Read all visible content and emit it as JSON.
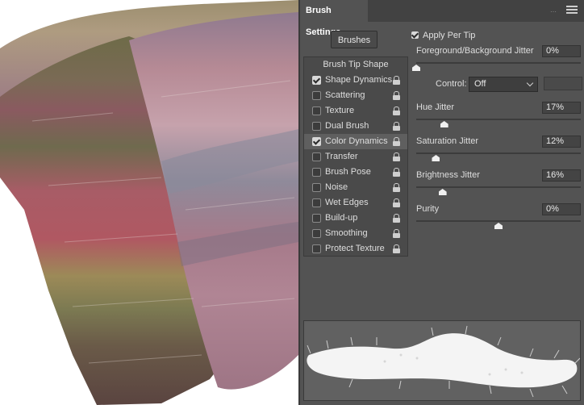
{
  "panel": {
    "tab_title": "Brush Settings",
    "brushes_button": "Brushes",
    "options": [
      {
        "label": "Brush Tip Shape",
        "checkbox": false,
        "checked": false,
        "lock": false,
        "selected": false
      },
      {
        "label": "Shape Dynamics",
        "checkbox": true,
        "checked": true,
        "lock": true,
        "selected": false
      },
      {
        "label": "Scattering",
        "checkbox": true,
        "checked": false,
        "lock": true,
        "selected": false
      },
      {
        "label": "Texture",
        "checkbox": true,
        "checked": false,
        "lock": true,
        "selected": false
      },
      {
        "label": "Dual Brush",
        "checkbox": true,
        "checked": false,
        "lock": true,
        "selected": false
      },
      {
        "label": "Color Dynamics",
        "checkbox": true,
        "checked": true,
        "lock": true,
        "selected": true
      },
      {
        "label": "Transfer",
        "checkbox": true,
        "checked": false,
        "lock": true,
        "selected": false
      },
      {
        "label": "Brush Pose",
        "checkbox": true,
        "checked": false,
        "lock": true,
        "selected": false
      },
      {
        "label": "Noise",
        "checkbox": true,
        "checked": false,
        "lock": true,
        "selected": false
      },
      {
        "label": "Wet Edges",
        "checkbox": true,
        "checked": false,
        "lock": true,
        "selected": false
      },
      {
        "label": "Build-up",
        "checkbox": true,
        "checked": false,
        "lock": true,
        "selected": false
      },
      {
        "label": "Smoothing",
        "checkbox": true,
        "checked": false,
        "lock": true,
        "selected": false
      },
      {
        "label": "Protect Texture",
        "checkbox": true,
        "checked": false,
        "lock": true,
        "selected": false
      }
    ],
    "apply_per_tip": {
      "label": "Apply Per Tip",
      "checked": true
    },
    "params": [
      {
        "key": "fg_bg",
        "label": "Foreground/Background Jitter",
        "value": "0%",
        "level": 0
      },
      {
        "key": "hue",
        "label": "Hue Jitter",
        "value": "17%",
        "level": 17
      },
      {
        "key": "saturation",
        "label": "Saturation Jitter",
        "value": "12%",
        "level": 12
      },
      {
        "key": "brightness",
        "label": "Brightness Jitter",
        "value": "16%",
        "level": 16
      },
      {
        "key": "purity",
        "label": "Purity",
        "value": "0%",
        "level": 0,
        "bipolar": true
      }
    ],
    "control": {
      "label": "Control:",
      "value": "Off"
    }
  },
  "colors": {
    "panel_bg": "#535353",
    "tab_bar": "#424242",
    "selected_row": "#5f5f5f",
    "stroke_olive": "#6e6b48",
    "stroke_rose": "#a8606a",
    "stroke_mauve": "#a7899e"
  }
}
